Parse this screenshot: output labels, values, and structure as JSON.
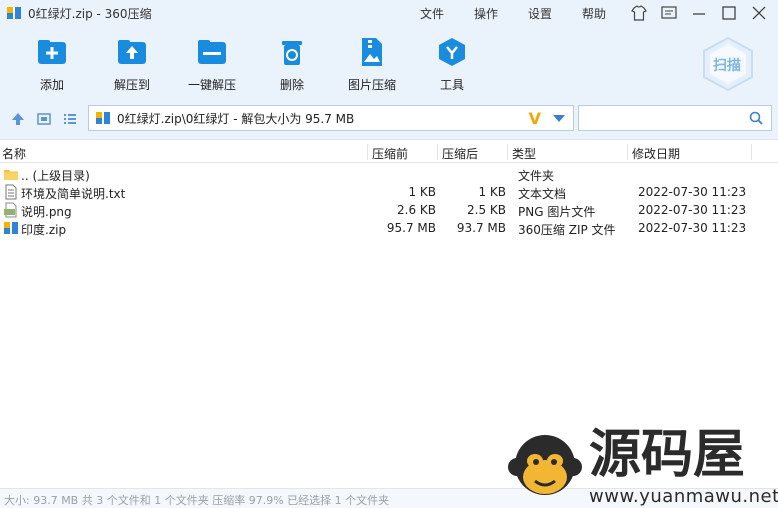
{
  "window": {
    "title": "0红绿灯.zip - 360压缩",
    "menus": [
      "文件",
      "操作",
      "设置",
      "帮助"
    ]
  },
  "toolbar": {
    "items": [
      {
        "label": "添加",
        "icon": "add-archive-icon"
      },
      {
        "label": "解压到",
        "icon": "extract-to-icon"
      },
      {
        "label": "一键解压",
        "icon": "one-click-extract-icon"
      },
      {
        "label": "删除",
        "icon": "delete-icon"
      },
      {
        "label": "图片压缩",
        "icon": "image-compress-icon"
      },
      {
        "label": "工具",
        "icon": "tools-icon"
      }
    ],
    "scan_label": "扫描"
  },
  "address": {
    "path": "0红绿灯.zip\\0红绿灯 - 解包大小为 95.7 MB",
    "search_placeholder": ""
  },
  "columns": {
    "name": "名称",
    "before": "压缩前",
    "after": "压缩后",
    "type": "类型",
    "modified": "修改日期"
  },
  "files": [
    {
      "name": ".. (上级目录)",
      "before": "",
      "after": "",
      "type": "文件夹",
      "modified": "",
      "icon": "folder-icon"
    },
    {
      "name": "环境及简单说明.txt",
      "before": "1 KB",
      "after": "1 KB",
      "type": "文本文档",
      "modified": "2022-07-30 11:23",
      "icon": "text-file-icon"
    },
    {
      "name": "说明.png",
      "before": "2.6 KB",
      "after": "2.5 KB",
      "type": "PNG 图片文件",
      "modified": "2022-07-30 11:23",
      "icon": "png-file-icon"
    },
    {
      "name": "印度.zip",
      "before": "95.7 MB",
      "after": "93.7 MB",
      "type": "360压缩 ZIP 文件",
      "modified": "2022-07-30 11:23",
      "icon": "zip-file-icon"
    }
  ],
  "status": "大小: 93.7 MB 共 3 个文件和 1 个文件夹 压缩率 97.9% 已经选择 1 个文件夹",
  "watermark": {
    "title": "源码屋",
    "url": "www.yuanmawu.net"
  },
  "colors": {
    "accent": "#1a8ce0",
    "chrome_bg": "#eaf3fc",
    "scan": "#7eb6ea"
  }
}
